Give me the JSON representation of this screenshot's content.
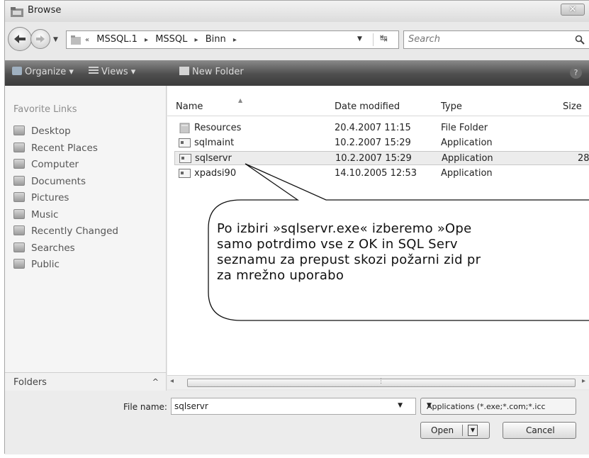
{
  "window": {
    "title": "Browse",
    "close_label": "✕"
  },
  "address": {
    "crumbs": [
      "«",
      "MSSQL.1",
      "▸",
      "MSSQL",
      "▸",
      "Binn",
      "▸"
    ],
    "search_placeholder": "Search"
  },
  "toolbar": {
    "organize": "Organize ▾",
    "views": "Views ▾",
    "new_folder": "New Folder",
    "help": "?"
  },
  "sidebar": {
    "title": "Favorite Links",
    "items": [
      {
        "label": "Desktop"
      },
      {
        "label": "Recent Places"
      },
      {
        "label": "Computer"
      },
      {
        "label": "Documents"
      },
      {
        "label": "Pictures"
      },
      {
        "label": "Music"
      },
      {
        "label": "Recently Changed"
      },
      {
        "label": "Searches"
      },
      {
        "label": "Public"
      }
    ],
    "folders_label": "Folders"
  },
  "files": {
    "columns": {
      "name": "Name",
      "date": "Date modified",
      "type": "Type",
      "size": "Size"
    },
    "rows": [
      {
        "name": "Resources",
        "date": "20.4.2007 11:15",
        "type": "File Folder",
        "size": ""
      },
      {
        "name": "sqlmaint",
        "date": "10.2.2007 15:29",
        "type": "Application",
        "size": ""
      },
      {
        "name": "sqlservr",
        "date": "10.2.2007 15:29",
        "type": "Application",
        "size": "28"
      },
      {
        "name": "xpadsi90",
        "date": "14.10.2005 12:53",
        "type": "Application",
        "size": ""
      }
    ]
  },
  "bottom": {
    "file_name_label": "File name:",
    "file_name_value": "sqlservr",
    "file_type": "Applications (*.exe;*.com;*.icc",
    "open_label": "Open",
    "cancel_label": "Cancel"
  },
  "callout": {
    "lines": [
      "Po izbiri »sqlservr.exe« izberemo »Ope",
      "samo potrdimo vse z OK in SQL Serv",
      "seznamu za prepust skozi požarni zid pr",
      "za mrežno uporabo"
    ]
  }
}
